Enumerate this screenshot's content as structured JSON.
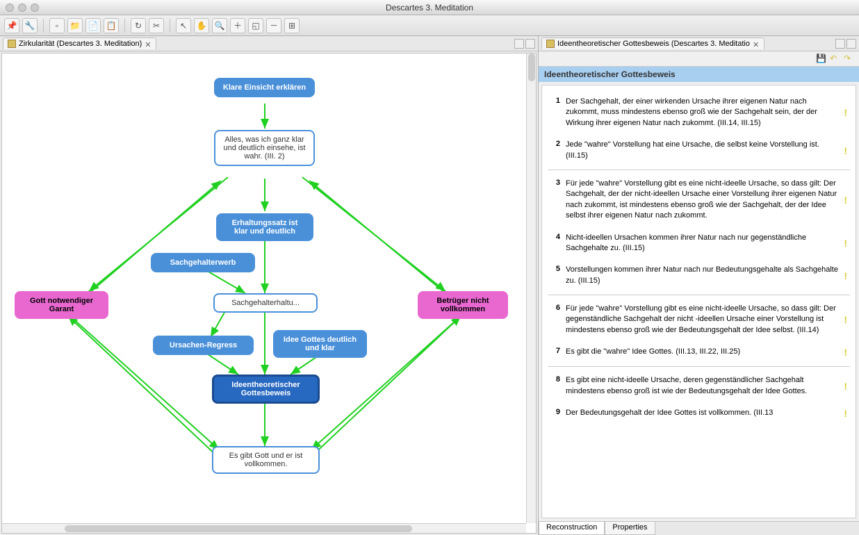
{
  "window": {
    "title": "Descartes 3. Meditation"
  },
  "toolbar": {
    "icons": [
      "pin",
      "wrench",
      "nav",
      "folder",
      "doc1",
      "doc2",
      "refresh",
      "cut",
      "arrow",
      "hand",
      "zoom-sel",
      "zoom-in",
      "zoom-fit",
      "zoom-out",
      "layout"
    ]
  },
  "left": {
    "tab": "Zirkularität (Descartes 3. Meditation)",
    "nodes": {
      "n1": "Klare Einsicht erklären",
      "n2": "Alles, was ich ganz klar und deutlich einsehe, ist wahr. (III. 2)",
      "n3": "Erhaltungssatz ist klar und deutlich",
      "n4": "Sachgehalterwerb",
      "n5": "Sachgehalterhaltu...",
      "n6": "Ursachen-Regress",
      "n7": "Idee Gottes deutlich und klar",
      "n8": "Ideentheoretischer Gottesbeweis",
      "n9": "Es gibt Gott und er ist vollkommen.",
      "n10": "Gott notwendiger Garant",
      "n11": "Betrüger nicht vollkommen"
    }
  },
  "right": {
    "tab": "Ideentheoretischer Gottesbeweis (Descartes 3. Meditatio",
    "header": "Ideentheoretischer Gottesbeweis",
    "steps": [
      {
        "n": "1",
        "t": "Der Sachgehalt, der einer wirkenden Ursache ihrer eigenen Natur nach zukommt, muss mindestens ebenso groß wie der Sachgehalt sein, der der Wirkung ihrer eigenen Natur nach zukommt. (III.14, III.15)",
        "sep": false
      },
      {
        "n": "2",
        "t": "Jede \"wahre\" Vorstellung hat eine Ursache, die selbst keine Vorstellung ist. (III.15)",
        "sep": true
      },
      {
        "n": "3",
        "t": "Für jede \"wahre\" Vorstellung gibt es eine nicht-ideelle Ursache, so dass gilt: Der Sachgehalt, der der nicht-ideellen Ursache einer Vorstellung ihrer eigenen Natur nach zukommt, ist mindestens ebenso groß wie der Sachgehalt, der der Idee selbst ihrer eigenen Natur nach zukommt.",
        "sep": false
      },
      {
        "n": "4",
        "t": "Nicht-ideellen Ursachen kommen ihrer Natur nach nur gegenständliche Sachgehalte zu. (III.15)",
        "sep": false
      },
      {
        "n": "5",
        "t": "Vorstellungen kommen ihrer Natur nach nur Bedeutungsgehalte als Sachgehalte zu. (III.15)",
        "sep": true
      },
      {
        "n": "6",
        "t": "Für jede \"wahre\" Vorstellung gibt es eine nicht-ideelle Ursache, so dass gilt: Der gegenständliche Sachgehalt der nicht -ideellen Ursache einer Vorstellung ist mindestens ebenso groß wie der Bedeutungsgehalt der Idee selbst. (III.14)",
        "sep": false
      },
      {
        "n": "7",
        "t": "Es gibt die \"wahre\" Idee Gottes. (III.13, III.22, III.25)",
        "sep": true
      },
      {
        "n": "8",
        "t": "Es gibt eine nicht-ideelle Ursache, deren gegenständlicher Sachgehalt mindestens ebenso groß ist wie der Bedeutungsgehalt der Idee Gottes.",
        "sep": false
      },
      {
        "n": "9",
        "t": "Der Bedeutungsgehalt der Idee Gottes ist vollkommen. (III.13",
        "sep": false
      }
    ],
    "bottom_tabs": [
      "Reconstruction",
      "Properties"
    ]
  }
}
